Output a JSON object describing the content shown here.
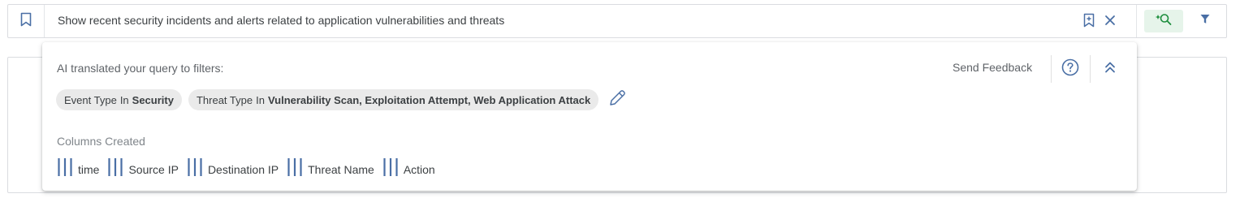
{
  "search": {
    "query": "Show recent security incidents and alerts related to application vulnerabilities and threats"
  },
  "ai_panel": {
    "title": "AI translated your query to filters:",
    "feedback_label": "Send Feedback",
    "filters": [
      {
        "field": "Event Type",
        "operator": "In",
        "value": "Security"
      },
      {
        "field": "Threat Type",
        "operator": "In",
        "value": "Vulnerability Scan, Exploitation Attempt, Web Application Attack"
      }
    ],
    "columns_title": "Columns Created",
    "columns": [
      "time",
      "Source IP",
      "Destination IP",
      "Threat Name",
      "Action"
    ]
  },
  "icons": {
    "bookmark": "bookmark-icon",
    "save_query": "bookmark-add-icon",
    "clear": "close-icon",
    "ai_search": "sparkle-search-icon",
    "filter": "funnel-icon",
    "help": "help-circle-icon",
    "collapse": "chevron-double-up-icon",
    "edit": "pencil-icon",
    "column": "column-bars-icon"
  },
  "colors": {
    "accent_blue": "#4a6fa5",
    "ai_green": "#1e8e3e",
    "ai_button_bg": "#e6f4ea",
    "chip_bg": "#eaeaea"
  }
}
